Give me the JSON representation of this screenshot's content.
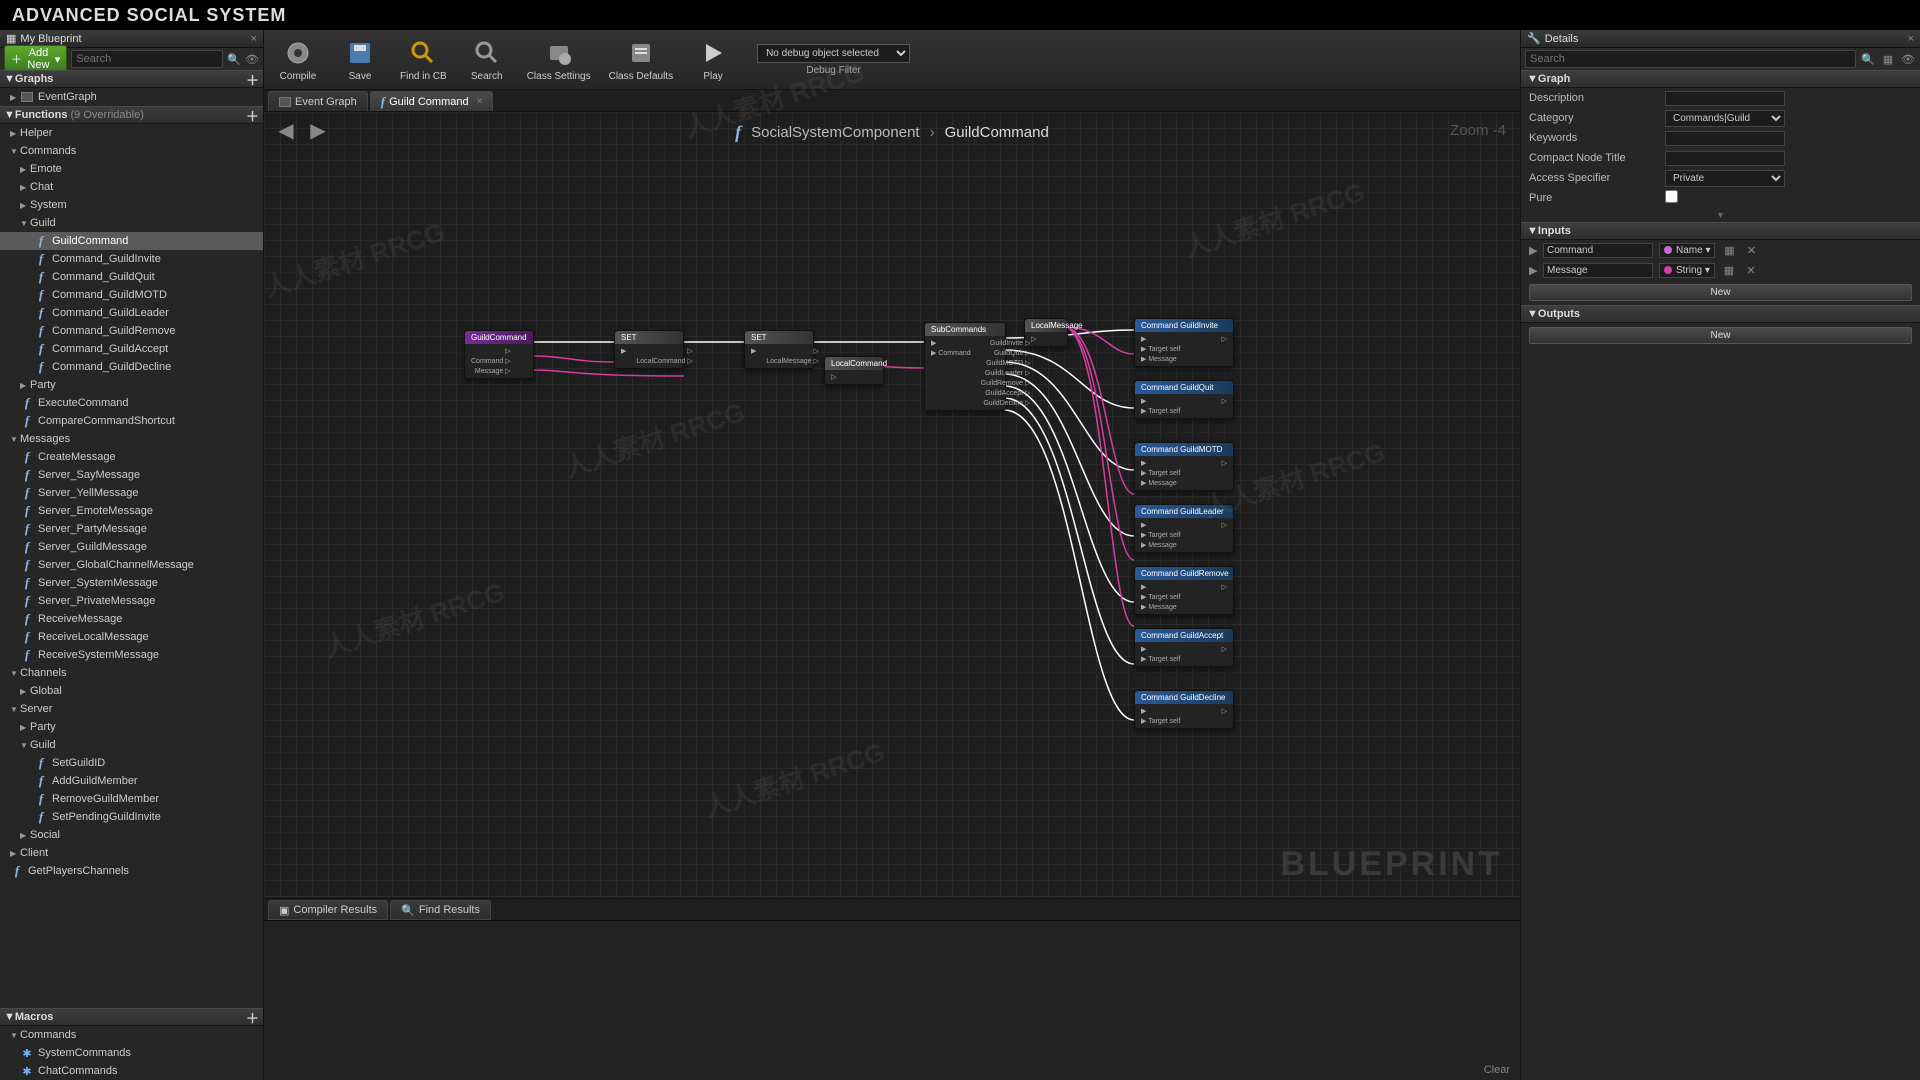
{
  "header": {
    "title": "ADVANCED SOCIAL SYSTEM"
  },
  "left": {
    "tab": "My Blueprint",
    "add_new": "Add New",
    "search_placeholder": "Search",
    "sections": {
      "graphs": "Graphs",
      "functions": "Functions",
      "functions_badge": "(9 Overridable)",
      "macros": "Macros"
    },
    "graphs_items": [
      {
        "label": "EventGraph",
        "icon": "event"
      }
    ],
    "fn_tree": [
      {
        "label": "Helper",
        "lv": 1,
        "arr": "▶"
      },
      {
        "label": "Commands",
        "lv": 1,
        "arr": "▼"
      },
      {
        "label": "Emote",
        "lv": 2,
        "arr": "▶"
      },
      {
        "label": "Chat",
        "lv": 2,
        "arr": "▶"
      },
      {
        "label": "System",
        "lv": 2,
        "arr": "▶"
      },
      {
        "label": "Guild",
        "lv": 2,
        "arr": "▼"
      },
      {
        "label": "GuildCommand",
        "lv": 3,
        "fn": true,
        "sel": true
      },
      {
        "label": "Command_GuildInvite",
        "lv": 3,
        "fn": true
      },
      {
        "label": "Command_GuildQuit",
        "lv": 3,
        "fn": true
      },
      {
        "label": "Command_GuildMOTD",
        "lv": 3,
        "fn": true
      },
      {
        "label": "Command_GuildLeader",
        "lv": 3,
        "fn": true
      },
      {
        "label": "Command_GuildRemove",
        "lv": 3,
        "fn": true
      },
      {
        "label": "Command_GuildAccept",
        "lv": 3,
        "fn": true
      },
      {
        "label": "Command_GuildDecline",
        "lv": 3,
        "fn": true
      },
      {
        "label": "Party",
        "lv": 2,
        "arr": "▶"
      },
      {
        "label": "ExecuteCommand",
        "lv": 2,
        "fn": true
      },
      {
        "label": "CompareCommandShortcut",
        "lv": 2,
        "fn": true
      },
      {
        "label": "Messages",
        "lv": 1,
        "arr": "▼"
      },
      {
        "label": "CreateMessage",
        "lv": 2,
        "fn": true
      },
      {
        "label": "Server_SayMessage",
        "lv": 2,
        "fn": true
      },
      {
        "label": "Server_YellMessage",
        "lv": 2,
        "fn": true
      },
      {
        "label": "Server_EmoteMessage",
        "lv": 2,
        "fn": true
      },
      {
        "label": "Server_PartyMessage",
        "lv": 2,
        "fn": true
      },
      {
        "label": "Server_GuildMessage",
        "lv": 2,
        "fn": true
      },
      {
        "label": "Server_GlobalChannelMessage",
        "lv": 2,
        "fn": true
      },
      {
        "label": "Server_SystemMessage",
        "lv": 2,
        "fn": true
      },
      {
        "label": "Server_PrivateMessage",
        "lv": 2,
        "fn": true
      },
      {
        "label": "ReceiveMessage",
        "lv": 2,
        "fn": true
      },
      {
        "label": "ReceiveLocalMessage",
        "lv": 2,
        "fn": true
      },
      {
        "label": "ReceiveSystemMessage",
        "lv": 2,
        "fn": true
      },
      {
        "label": "Channels",
        "lv": 1,
        "arr": "▼"
      },
      {
        "label": "Global",
        "lv": 2,
        "arr": "▶"
      },
      {
        "label": "Server",
        "lv": 1,
        "arr": "▼"
      },
      {
        "label": "Party",
        "lv": 2,
        "arr": "▶"
      },
      {
        "label": "Guild",
        "lv": 2,
        "arr": "▼"
      },
      {
        "label": "SetGuildID",
        "lv": 3,
        "fn": true
      },
      {
        "label": "AddGuildMember",
        "lv": 3,
        "fn": true
      },
      {
        "label": "RemoveGuildMember",
        "lv": 3,
        "fn": true
      },
      {
        "label": "SetPendingGuildInvite",
        "lv": 3,
        "fn": true
      },
      {
        "label": "Social",
        "lv": 2,
        "arr": "▶"
      },
      {
        "label": "Client",
        "lv": 1,
        "arr": "▶"
      },
      {
        "label": "GetPlayersChannels",
        "lv": 1,
        "fn": true
      }
    ],
    "macros_tree": [
      {
        "label": "Commands",
        "lv": 1,
        "arr": "▼"
      },
      {
        "label": "SystemCommands",
        "lv": 2,
        "cmd": true
      },
      {
        "label": "ChatCommands",
        "lv": 2,
        "cmd": true
      }
    ]
  },
  "toolbar": {
    "compile": "Compile",
    "save": "Save",
    "find": "Find in CB",
    "search": "Search",
    "class_settings": "Class Settings",
    "class_defaults": "Class Defaults",
    "play": "Play",
    "debug_selected": "No debug object selected",
    "debug_filter": "Debug Filter"
  },
  "tabs": {
    "event_graph": "Event Graph",
    "guild_command": "Guild Command"
  },
  "graph": {
    "breadcrumb_parent": "SocialSystemComponent",
    "breadcrumb_child": "GuildCommand",
    "zoom": "Zoom -4",
    "watermark": "BLUEPRINT",
    "nodes": {
      "entry": {
        "title": "GuildCommand",
        "in": [],
        "out": [
          "",
          "Command",
          "Message"
        ]
      },
      "set1": {
        "title": "SET",
        "in": [
          ""
        ],
        "out": [
          "",
          "LocalCommand"
        ]
      },
      "set2": {
        "title": "SET",
        "in": [
          ""
        ],
        "out": [
          "",
          "LocalMessage"
        ]
      },
      "local1": {
        "title": "LocalCommand"
      },
      "local2": {
        "title": "LocalMessage"
      },
      "switch": {
        "title": "SubCommands",
        "in": [
          "",
          "Command"
        ],
        "out": [
          "GuildInvite",
          "GuildQuit",
          "GuildMOTD",
          "GuildLeader",
          "GuildRemove",
          "GuildAccept",
          "GuildDecline"
        ]
      },
      "calls": [
        {
          "title": "Command GuildInvite",
          "pins": [
            "",
            "Target self",
            "Message"
          ]
        },
        {
          "title": "Command GuildQuit",
          "pins": [
            "",
            "Target self"
          ]
        },
        {
          "title": "Command GuildMOTD",
          "pins": [
            "",
            "Target self",
            "Message"
          ]
        },
        {
          "title": "Command GuildLeader",
          "pins": [
            "",
            "Target self",
            "Message"
          ]
        },
        {
          "title": "Command GuildRemove",
          "pins": [
            "",
            "Target self",
            "Message"
          ]
        },
        {
          "title": "Command GuildAccept",
          "pins": [
            "",
            "Target self"
          ]
        },
        {
          "title": "Command GuildDecline",
          "pins": [
            "",
            "Target self"
          ]
        }
      ]
    }
  },
  "bottom": {
    "compiler": "Compiler Results",
    "find": "Find Results",
    "clear": "Clear"
  },
  "details": {
    "tab": "Details",
    "search_placeholder": "Search",
    "graph_section": "Graph",
    "desc_label": "Description",
    "category_label": "Category",
    "category_val": "Commands|Guild",
    "keywords_label": "Keywords",
    "compact_label": "Compact Node Title",
    "access_label": "Access Specifier",
    "access_val": "Private",
    "pure_label": "Pure",
    "inputs_section": "Inputs",
    "inputs": [
      {
        "name": "Command",
        "type": "Name",
        "color": "#c668d8"
      },
      {
        "name": "Message",
        "type": "String",
        "color": "#d63ea4"
      }
    ],
    "outputs_section": "Outputs",
    "new_btn": "New"
  },
  "watermark_text": "人人素材 RRCG"
}
